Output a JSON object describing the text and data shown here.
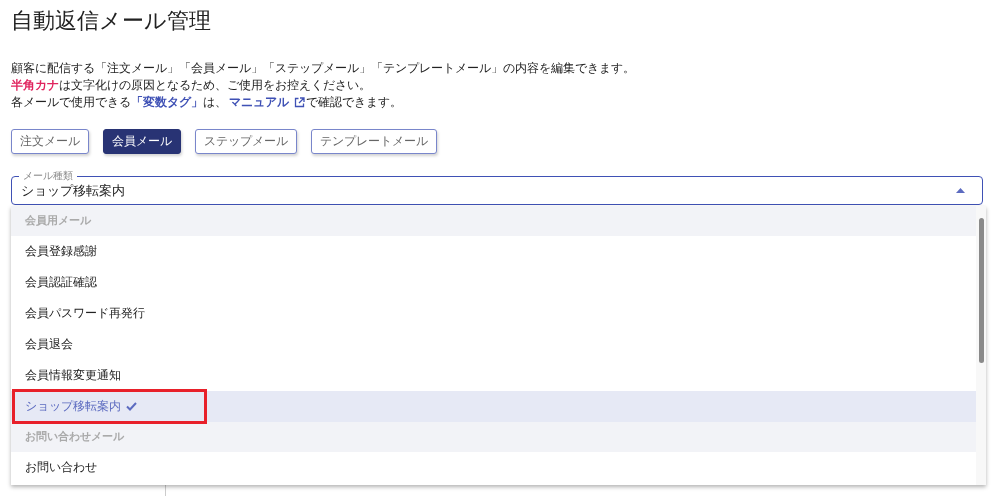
{
  "title": "自動返信メール管理",
  "description": [
    [
      {
        "kind": "plain",
        "text": "顧客に配信する「注文メール」「会員メール」「ステップメール」「テンプレートメール」の内容を編集できます。"
      }
    ],
    [
      {
        "kind": "warn",
        "text": "半角カナ"
      },
      {
        "kind": "plain",
        "text": "は文字化けの原因となるため、ご使用をお控えください。"
      }
    ],
    [
      {
        "kind": "plain",
        "text": "各メールで使用できる"
      },
      {
        "kind": "tag",
        "text": "「変数タグ」"
      },
      {
        "kind": "plain",
        "text": "は、"
      },
      {
        "kind": "link",
        "text": "マニュアル"
      },
      {
        "kind": "plain",
        "text": "で確認できます。"
      }
    ]
  ],
  "tabs": [
    {
      "label": "注文メール",
      "selected": false
    },
    {
      "label": "会員メール",
      "selected": true
    },
    {
      "label": "ステップメール",
      "selected": false
    },
    {
      "label": "テンプレートメール",
      "selected": false
    }
  ],
  "select": {
    "label": "メール種類",
    "value": "ショップ移転案内",
    "expanded": true
  },
  "options": [
    {
      "kind": "group",
      "label": "会員用メール"
    },
    {
      "kind": "option",
      "label": "会員登録感謝",
      "selected": false
    },
    {
      "kind": "option",
      "label": "会員認証確認",
      "selected": false
    },
    {
      "kind": "option",
      "label": "会員パスワード再発行",
      "selected": false
    },
    {
      "kind": "option",
      "label": "会員退会",
      "selected": false
    },
    {
      "kind": "option",
      "label": "会員情報変更通知",
      "selected": false
    },
    {
      "kind": "option",
      "label": "ショップ移転案内",
      "selected": true
    },
    {
      "kind": "group",
      "label": "お問い合わせメール"
    },
    {
      "kind": "option",
      "label": "お問い合わせ",
      "selected": false
    }
  ]
}
